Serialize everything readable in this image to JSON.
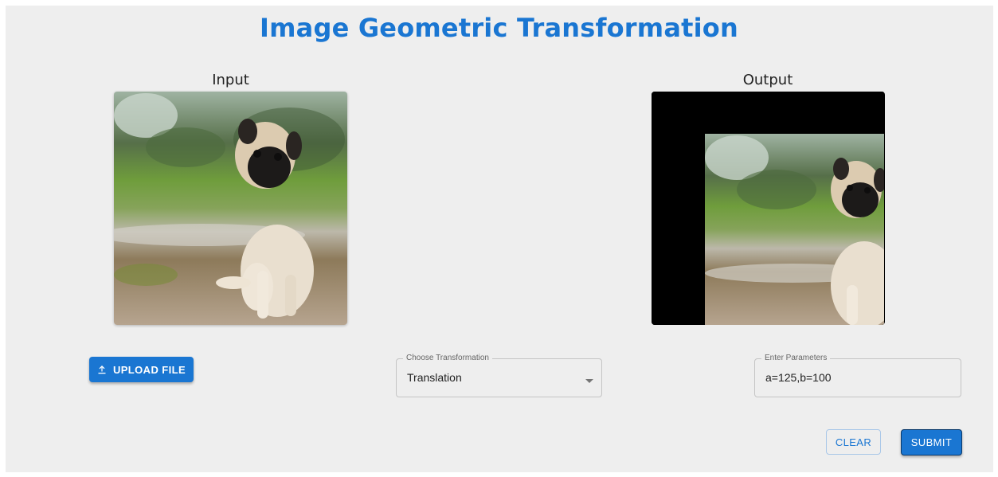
{
  "header": {
    "title": "Image Geometric Transformation"
  },
  "input_panel": {
    "caption": "Input",
    "image_alt": "pug puppy sitting on a gravel path"
  },
  "output_panel": {
    "caption": "Output",
    "image_alt": "pug puppy image translated right and down with black fill"
  },
  "controls": {
    "upload_label": "UPLOAD FILE",
    "transformation": {
      "legend": "Choose Transformation",
      "selected": "Translation"
    },
    "parameters": {
      "legend": "Enter Parameters",
      "value": "a=125,b=100"
    },
    "clear_label": "CLEAR",
    "submit_label": "SUBMIT"
  },
  "colors": {
    "accent": "#1a76d2",
    "panel_background": "#eeeeee"
  },
  "icons": {
    "upload": "upload-icon",
    "dropdown": "caret-down-icon"
  }
}
